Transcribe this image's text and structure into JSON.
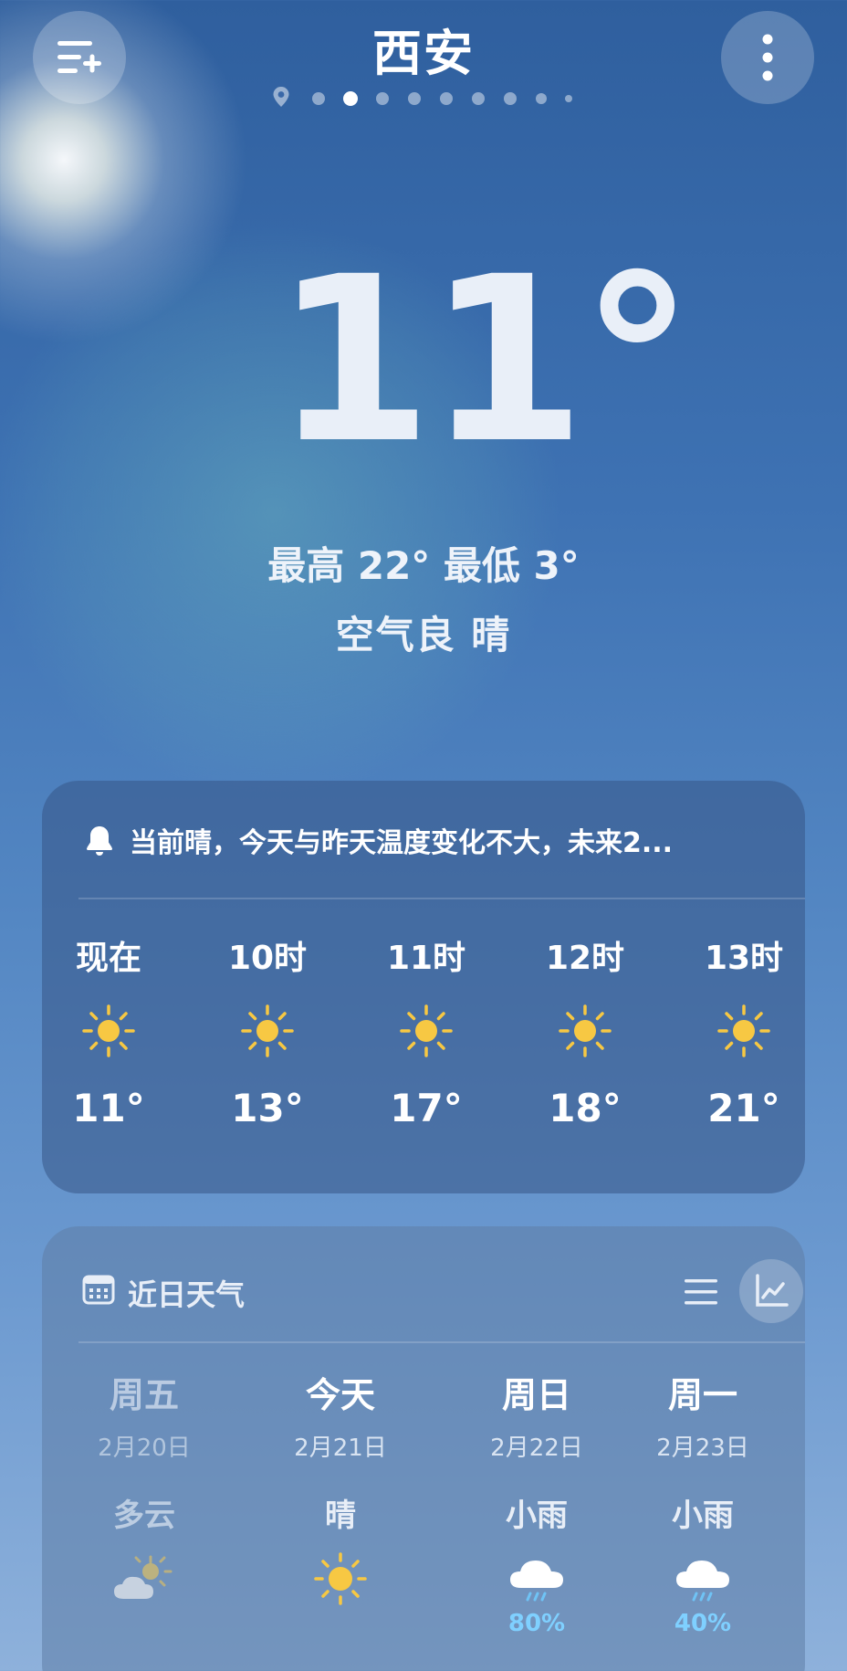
{
  "city": "西安",
  "current": {
    "temperature": "11°",
    "hi_lo": "最高 22° 最低 3°",
    "aqi_condition": "空气良  晴"
  },
  "pager": {
    "total_pages": 9,
    "active_index": 2
  },
  "alert": {
    "text": "当前晴，今天与昨天温度变化不大，未来2..."
  },
  "hourly": [
    {
      "label": "现在",
      "icon": "sun-icon",
      "temp": "11°"
    },
    {
      "label": "10时",
      "icon": "sun-icon",
      "temp": "13°"
    },
    {
      "label": "11时",
      "icon": "sun-icon",
      "temp": "17°"
    },
    {
      "label": "12时",
      "icon": "sun-icon",
      "temp": "18°"
    },
    {
      "label": "13时",
      "icon": "sun-icon",
      "temp": "21°"
    }
  ],
  "daily": {
    "title": "近日天气",
    "days": [
      {
        "name": "周五",
        "date": "2月20日",
        "cond": "多云",
        "icon": "partly-cloudy-icon",
        "pop": ""
      },
      {
        "name": "今天",
        "date": "2月21日",
        "cond": "晴",
        "icon": "sun-icon",
        "pop": ""
      },
      {
        "name": "周日",
        "date": "2月22日",
        "cond": "小雨",
        "icon": "light-rain-icon",
        "pop": "80%"
      },
      {
        "name": "周一",
        "date": "2月23日",
        "cond": "小雨",
        "icon": "light-rain-icon",
        "pop": "40%"
      }
    ]
  },
  "colors": {
    "accent_rain": "#7fd0ff",
    "sun": "#f7c843"
  }
}
